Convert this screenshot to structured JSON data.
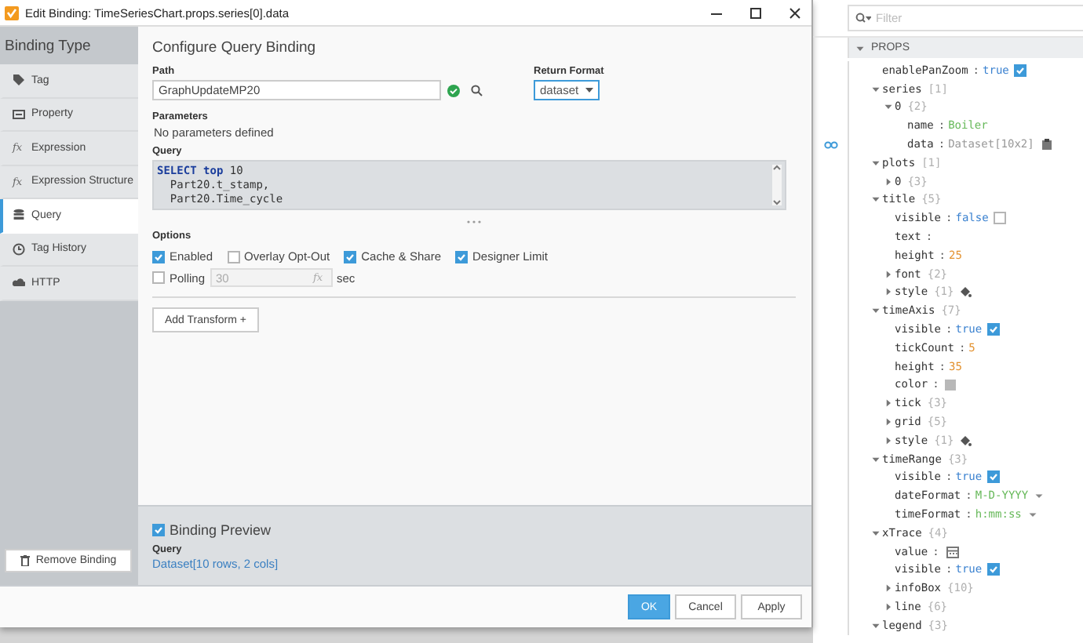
{
  "dialog": {
    "title": "Edit Binding: TimeSeriesChart.props.series[0].data",
    "sidebar": {
      "title": "Binding Type",
      "items": [
        {
          "label": "Tag",
          "selected": false
        },
        {
          "label": "Property",
          "selected": false
        },
        {
          "label": "Expression",
          "selected": false,
          "glyph": "fx"
        },
        {
          "label": "Expression Structure",
          "selected": false,
          "glyph": "fx"
        },
        {
          "label": "Query",
          "selected": true
        },
        {
          "label": "Tag History",
          "selected": false
        },
        {
          "label": "HTTP",
          "selected": false
        }
      ],
      "remove_button": "Remove Binding"
    },
    "main": {
      "heading": "Configure Query Binding",
      "path_label": "Path",
      "path_value": "GraphUpdateMP20",
      "return_format_label": "Return Format",
      "return_format": "dataset",
      "parameters_label": "Parameters",
      "parameters_text": "No parameters defined",
      "query_label": "Query",
      "code": [
        {
          "tokens": [
            {
              "text": "SELECT",
              "kind": "keyword"
            },
            {
              "text": " top",
              "kind": "keyword"
            },
            {
              "text": " 10",
              "kind": "plain"
            }
          ]
        },
        {
          "tokens": [
            {
              "text": "  Part20.t_stamp,",
              "kind": "plain"
            }
          ]
        },
        {
          "tokens": [
            {
              "text": "  Part20.Time_cycle",
              "kind": "plain"
            }
          ]
        }
      ],
      "options_label": "Options",
      "options": [
        {
          "label": "Enabled",
          "checked": true
        },
        {
          "label": "Overlay Opt-Out",
          "checked": false
        },
        {
          "label": "Cache & Share",
          "checked": true
        },
        {
          "label": "Designer Limit",
          "checked": true
        }
      ],
      "polling": {
        "label": "Polling",
        "checked": false,
        "value": "30",
        "disabled": true,
        "glyph": "fx",
        "unit": "sec"
      },
      "add_transform": "Add Transform +"
    },
    "preview": {
      "label": "Binding Preview",
      "checked": true,
      "query_label": "Query",
      "result": "Dataset[10 rows, 2 cols]"
    },
    "buttons": [
      {
        "label": "OK",
        "kind": "primary"
      },
      {
        "label": "Cancel",
        "kind": "secondary"
      },
      {
        "label": "Apply",
        "kind": "secondary"
      }
    ]
  },
  "props": {
    "filter_placeholder": "Filter",
    "section": "PROPS",
    "expanded": true,
    "separator": ":",
    "items": [
      {
        "name": "enablePanZoom",
        "kind": "boolean",
        "value": "true",
        "checked": true
      },
      {
        "name": "series",
        "count": "[1]",
        "kind": "object",
        "expanded": true,
        "children": [
          {
            "name": "0",
            "count": "{2}",
            "kind": "object",
            "expanded": true,
            "children": [
              {
                "name": "name",
                "kind": "string",
                "value": "Boiler"
              },
              {
                "name": "data",
                "kind": "dataset",
                "value": "Dataset[10x2]",
                "bound": true
              }
            ]
          }
        ]
      },
      {
        "name": "plots",
        "count": "[1]",
        "kind": "object",
        "expanded": true,
        "children": [
          {
            "name": "0",
            "count": "{3}",
            "kind": "object",
            "expanded": false
          }
        ]
      },
      {
        "name": "title",
        "count": "{5}",
        "kind": "object",
        "expanded": true,
        "children": [
          {
            "name": "visible",
            "kind": "boolean",
            "value": "false",
            "checked": false
          },
          {
            "name": "text",
            "kind": "string"
          },
          {
            "name": "height",
            "kind": "number",
            "value": "25"
          },
          {
            "name": "font",
            "count": "{2}",
            "kind": "object",
            "expanded": false
          },
          {
            "name": "style",
            "count": "{1}",
            "kind": "style",
            "expanded": false
          }
        ]
      },
      {
        "name": "timeAxis",
        "count": "{7}",
        "kind": "object",
        "expanded": true,
        "children": [
          {
            "name": "visible",
            "kind": "boolean",
            "value": "true",
            "checked": true
          },
          {
            "name": "tickCount",
            "kind": "number",
            "value": "5"
          },
          {
            "name": "height",
            "kind": "number",
            "value": "35"
          },
          {
            "name": "color",
            "kind": "color"
          },
          {
            "name": "tick",
            "count": "{3}",
            "kind": "object",
            "expanded": false
          },
          {
            "name": "grid",
            "count": "{5}",
            "kind": "object",
            "expanded": false
          },
          {
            "name": "style",
            "count": "{1}",
            "kind": "style",
            "expanded": false
          }
        ]
      },
      {
        "name": "timeRange",
        "count": "{3}",
        "kind": "object",
        "expanded": true,
        "children": [
          {
            "name": "visible",
            "kind": "boolean",
            "value": "true",
            "checked": true
          },
          {
            "name": "dateFormat",
            "kind": "enum",
            "value": "M-D-YYYY"
          },
          {
            "name": "timeFormat",
            "kind": "enum",
            "value": "h:mm:ss"
          }
        ]
      },
      {
        "name": "xTrace",
        "count": "{4}",
        "kind": "object",
        "expanded": true,
        "children": [
          {
            "name": "value",
            "kind": "date"
          },
          {
            "name": "visible",
            "kind": "boolean",
            "value": "true",
            "checked": true
          },
          {
            "name": "infoBox",
            "count": "{10}",
            "kind": "object",
            "expanded": false
          },
          {
            "name": "line",
            "count": "{6}",
            "kind": "object",
            "expanded": false
          }
        ]
      },
      {
        "name": "legend",
        "count": "{3}",
        "kind": "object",
        "expanded": true
      }
    ]
  }
}
